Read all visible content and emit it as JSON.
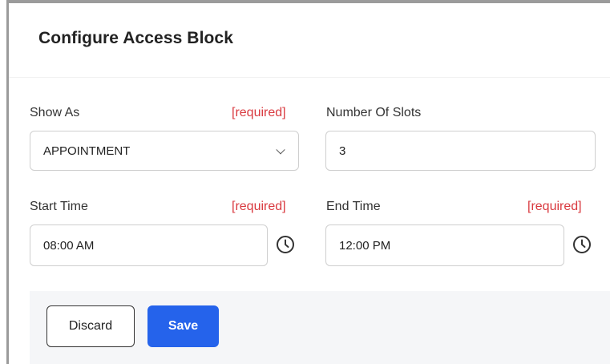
{
  "dialog": {
    "title": "Configure Access Block"
  },
  "form": {
    "show_as": {
      "label": "Show As",
      "required": "[required]",
      "value": "APPOINTMENT"
    },
    "number_of_slots": {
      "label": "Number Of Slots",
      "value": "3"
    },
    "start_time": {
      "label": "Start Time",
      "required": "[required]",
      "value": "08:00 AM",
      "icon": "clock-icon"
    },
    "end_time": {
      "label": "End Time",
      "required": "[required]",
      "value": "12:00 PM",
      "icon": "clock-icon"
    }
  },
  "actions": {
    "discard_label": "Discard",
    "save_label": "Save"
  },
  "colors": {
    "required": "#d9393f",
    "primary": "#2563eb",
    "footer_bg": "#f5f6f8"
  }
}
